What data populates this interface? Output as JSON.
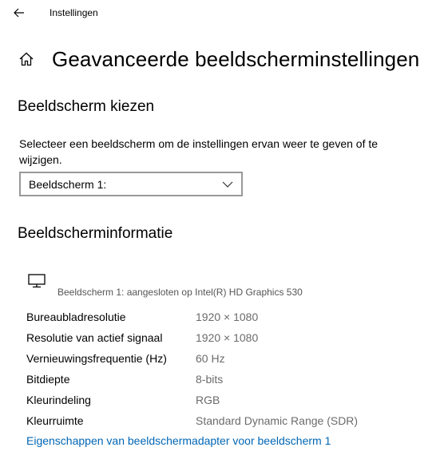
{
  "titlebar": {
    "app_title": "Instellingen",
    "back_icon": "arrow-left-icon"
  },
  "header": {
    "home_icon": "home-icon",
    "title": "Geavanceerde beeldscherminstellingen"
  },
  "choose_display": {
    "heading": "Beeldscherm kiezen",
    "description": "Selecteer een beeldscherm om de instellingen ervan weer te geven of te wijzigen.",
    "dropdown_value": "Beeldscherm 1:"
  },
  "display_info": {
    "heading": "Beeldscherminformatie",
    "monitor_icon": "monitor-icon",
    "subtitle": "Beeldscherm 1: aangesloten op Intel(R) HD Graphics 530",
    "rows": [
      {
        "label": "Bureaubladresolutie",
        "value": "1920 × 1080"
      },
      {
        "label": "Resolutie van actief signaal",
        "value": "1920 × 1080"
      },
      {
        "label": "Vernieuwingsfrequentie (Hz)",
        "value": "60 Hz"
      },
      {
        "label": "Bitdiepte",
        "value": "8-bits"
      },
      {
        "label": "Kleurindeling",
        "value": "RGB"
      },
      {
        "label": "Kleurruimte",
        "value": "Standard Dynamic Range (SDR)"
      }
    ],
    "adapter_link": "Eigenschappen van beeldschermadapter voor beeldscherm 1"
  },
  "colors": {
    "link": "#0066b4",
    "value_text": "#6b6b6b",
    "dropdown_border": "#999999"
  }
}
